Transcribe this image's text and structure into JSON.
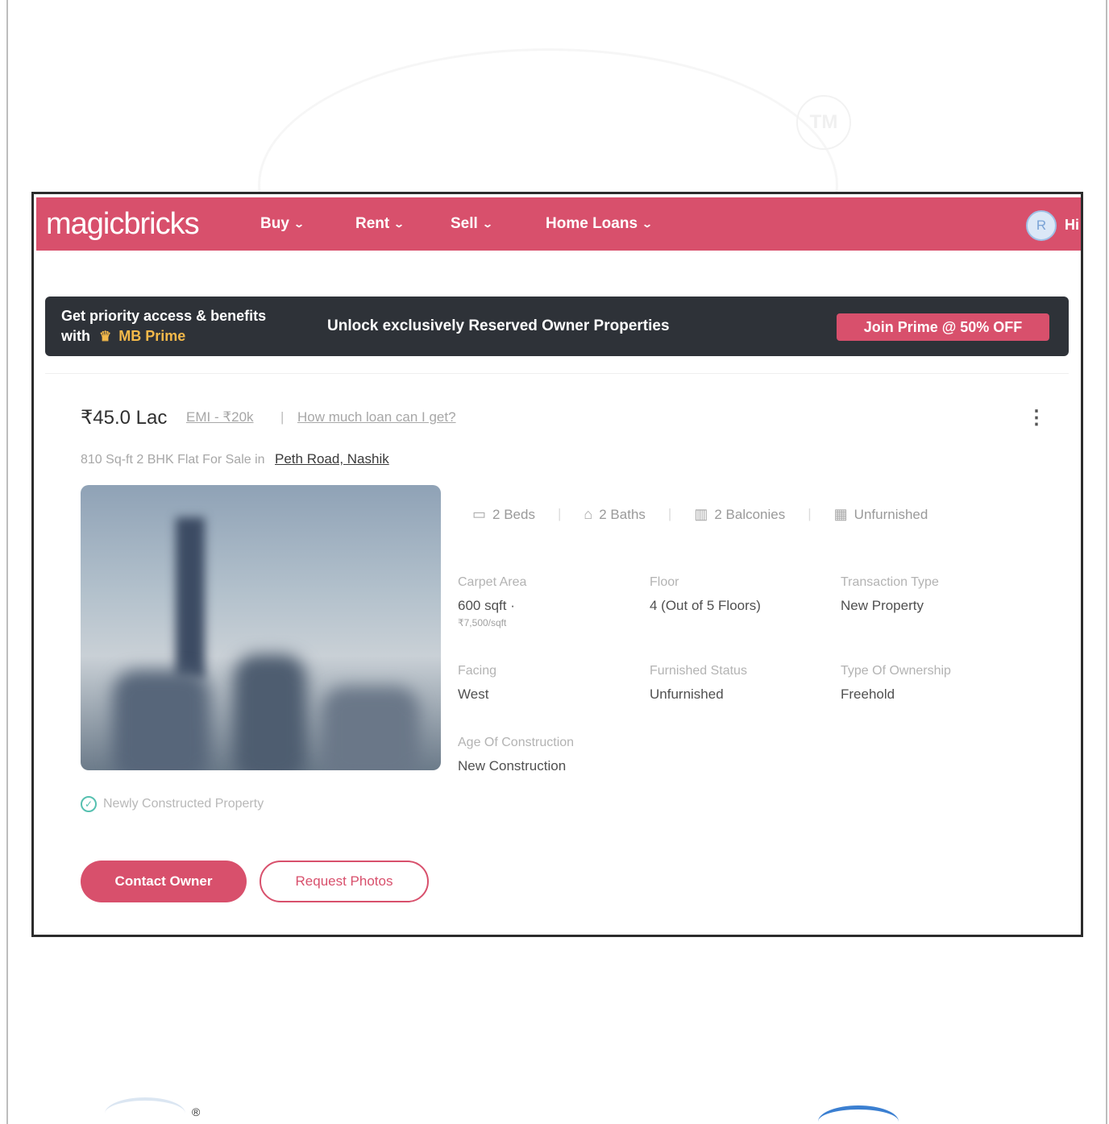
{
  "watermark": {
    "tm": "TM"
  },
  "navbar": {
    "logo": "magicbricks",
    "items": [
      {
        "label": "Buy"
      },
      {
        "label": "Rent"
      },
      {
        "label": "Sell"
      },
      {
        "label": "Home Loans"
      }
    ],
    "user_initial": "R",
    "greeting": "Hi",
    "accent_color": "#d8506c"
  },
  "prime_banner": {
    "line1": "Get priority access & benefits",
    "line2_prefix": "with",
    "brand": "MB Prime",
    "crown_icon": "crown-icon",
    "unlock_text": "Unlock exclusively Reserved Owner Properties",
    "cta": "Join Prime @ 50% OFF"
  },
  "listing": {
    "price": "₹45.0 Lac",
    "emi": "EMI - ₹20k",
    "separator": "|",
    "loan_link": "How much loan can I get?",
    "subtitle": "810 Sq-ft 2 BHK Flat For Sale in",
    "locality": "Peth Road, Nashik",
    "summary": [
      {
        "icon": "bed-icon",
        "label": "2 Beds"
      },
      {
        "icon": "bath-icon",
        "label": "2 Baths"
      },
      {
        "icon": "balcony-icon",
        "label": "2 Balconies"
      },
      {
        "icon": "furnish-icon",
        "label": "Unfurnished"
      }
    ],
    "details": [
      {
        "label": "Carpet Area",
        "value": "600 sqft ·",
        "sub": "₹7,500/sqft"
      },
      {
        "label": "Floor",
        "value": "4 (Out of 5 Floors)"
      },
      {
        "label": "Transaction Type",
        "value": "New Property"
      },
      {
        "label": "Facing",
        "value": "West"
      },
      {
        "label": "Furnished Status",
        "value": "Unfurnished"
      },
      {
        "label": "Type Of Ownership",
        "value": "Freehold"
      },
      {
        "label": "Age Of Construction",
        "value": "New Construction"
      }
    ],
    "newly_constructed": "Newly Constructed Property",
    "contact_button": "Contact Owner",
    "request_button": "Request Photos"
  },
  "bottom": {
    "reg_mark": "®"
  }
}
